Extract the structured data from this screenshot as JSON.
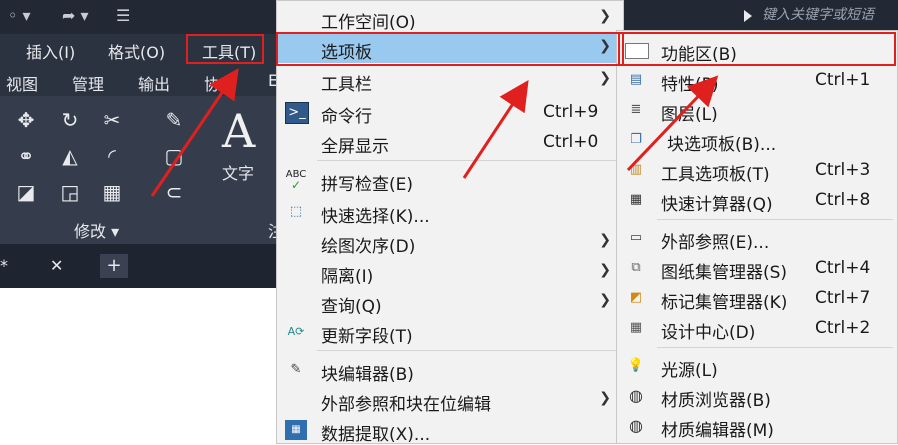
{
  "search": {
    "placeholder": "键入关键字或短语"
  },
  "menubar": {
    "items": [
      "插入(I)",
      "格式(O)",
      "工具(T)"
    ]
  },
  "ribbon_tabs": [
    "视图",
    "管理",
    "输出",
    "协作",
    "E"
  ],
  "ribbon": {
    "modify_label": "修改 ▾",
    "text_label": "文字",
    "text_glyph": "A",
    "panel_trail": "注"
  },
  "doc_tabs": {
    "star": "*",
    "close": "✕",
    "add": "+"
  },
  "tools_menu": {
    "items": [
      {
        "label": "工作空间(O)",
        "shortcut": "",
        "submenu": true
      },
      {
        "label": "选项板",
        "shortcut": "",
        "submenu": true
      },
      {
        "label": "工具栏",
        "shortcut": "",
        "submenu": true
      },
      {
        "label": "命令行",
        "shortcut": "Ctrl+9",
        "submenu": false
      },
      {
        "label": "全屏显示",
        "shortcut": "Ctrl+0",
        "submenu": false
      },
      {
        "label": "拼写检查(E)",
        "shortcut": "",
        "submenu": false
      },
      {
        "label": "快速选择(K)...",
        "shortcut": "",
        "submenu": false
      },
      {
        "label": "绘图次序(D)",
        "shortcut": "",
        "submenu": true
      },
      {
        "label": "隔离(I)",
        "shortcut": "",
        "submenu": true
      },
      {
        "label": "查询(Q)",
        "shortcut": "",
        "submenu": true
      },
      {
        "label": "更新字段(T)",
        "shortcut": "",
        "submenu": false
      },
      {
        "label": "块编辑器(B)",
        "shortcut": "",
        "submenu": false
      },
      {
        "label": "外部参照和块在位编辑",
        "shortcut": "",
        "submenu": true
      },
      {
        "label": "数据提取(X)...",
        "shortcut": "",
        "submenu": false
      }
    ]
  },
  "palettes_menu": {
    "items": [
      {
        "label": "功能区(B)",
        "shortcut": ""
      },
      {
        "label": "特性(P)",
        "shortcut": "Ctrl+1"
      },
      {
        "label": "图层(L)",
        "shortcut": ""
      },
      {
        "label": "块选项板(B)...",
        "shortcut": ""
      },
      {
        "label": "工具选项板(T)",
        "shortcut": "Ctrl+3"
      },
      {
        "label": "快速计算器(Q)",
        "shortcut": "Ctrl+8"
      },
      {
        "label": "外部参照(E)...",
        "shortcut": ""
      },
      {
        "label": "图纸集管理器(S)",
        "shortcut": "Ctrl+4"
      },
      {
        "label": "标记集管理器(K)",
        "shortcut": "Ctrl+7"
      },
      {
        "label": "设计中心(D)",
        "shortcut": "Ctrl+2"
      },
      {
        "label": "光源(L)",
        "shortcut": ""
      },
      {
        "label": "材质浏览器(B)",
        "shortcut": ""
      },
      {
        "label": "材质编辑器(M)",
        "shortcut": ""
      }
    ]
  },
  "colors": {
    "highlight": "#99c9ef",
    "annotation_red": "#e0201e",
    "dark_bg": "#2b3240"
  }
}
